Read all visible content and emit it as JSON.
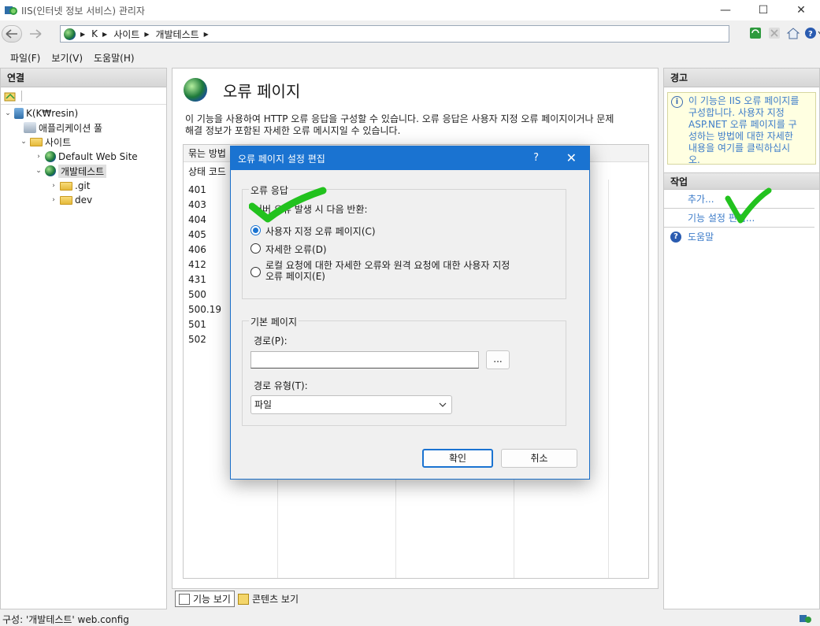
{
  "window": {
    "title": "IIS(인터넷 정보 서비스) 관리자",
    "minimize": "—",
    "maximize": "☐",
    "close": "✕"
  },
  "address": {
    "segments": [
      "K",
      "사이트",
      "개발테스트"
    ]
  },
  "menu": [
    "파일(F)",
    "보기(V)",
    "도움말(H)"
  ],
  "connections": {
    "header": "연결",
    "tree": [
      {
        "label": "K(K₩resin)",
        "level": 0,
        "twisty": "⌄",
        "icon": "server"
      },
      {
        "label": "애플리케이션 풀",
        "level": 1,
        "twisty": "",
        "icon": "pool"
      },
      {
        "label": "사이트",
        "level": 1,
        "twisty": "⌄",
        "icon": "folder"
      },
      {
        "label": "Default Web Site",
        "level": 2,
        "twisty": "›",
        "icon": "globe"
      },
      {
        "label": "개발테스트",
        "level": 2,
        "twisty": "⌄",
        "icon": "globe",
        "selected": true
      },
      {
        "label": ".git",
        "level": 3,
        "twisty": "›",
        "icon": "folder"
      },
      {
        "label": "dev",
        "level": 3,
        "twisty": "›",
        "icon": "folder"
      }
    ]
  },
  "center": {
    "title": "오류 페이지",
    "description_1": "이 기능을 사용하여 HTTP 오류 응답을 구성할 수 있습니다. 오류 응답은 사용자 지정 오류 페이지이거나 문제",
    "description_2": "해결 정보가 포함된 자세한 오류 메시지일 수 있습니다.",
    "group_label": "묶는 방법",
    "column_status": "상태 코드",
    "status_codes": [
      "401",
      "403",
      "404",
      "405",
      "406",
      "412",
      "431",
      "500",
      "500.19",
      "501",
      "502"
    ],
    "tab_features": "기능 보기",
    "tab_content": "콘텐츠 보기"
  },
  "alerts": {
    "header": "경고",
    "message_lines": [
      "이 기능은 IIS 오류 페이지를",
      "구성합니다. 사용자 지정",
      "ASP.NET 오류 페이지를 구",
      "성하는 방법에 대한 자세한",
      "내용을 여기를 클릭하십시",
      "오."
    ]
  },
  "actions": {
    "header": "작업",
    "add": "추가...",
    "edit_feature": "기능 설정 편집...",
    "help": "도움말"
  },
  "status": "구성: '개발테스트' web.config",
  "dialog": {
    "title": "오류 페이지 설정 편집",
    "help": "?",
    "close": "✕",
    "error_response_legend": "오류 응답",
    "prompt": "서버 오류 발생 시 다음 반환:",
    "options": [
      {
        "label": "사용자 지정 오류 페이지(C)",
        "selected": true
      },
      {
        "label": "자세한 오류(D)",
        "selected": false
      },
      {
        "label_1": "로컬 요청에 대한 자세한 오류와 원격 요청에 대한 사용자 지정",
        "label_2": "오류 페이지(E)",
        "selected": false
      }
    ],
    "default_page_legend": "기본 페이지",
    "path_label": "경로(P):",
    "path_value": "",
    "browse": "...",
    "path_type_label": "경로 유형(T):",
    "path_type_value": "파일",
    "ok": "확인",
    "cancel": "취소"
  },
  "colors": {
    "accent": "#1a73d1",
    "link": "#3d7cc9",
    "check": "#22c21e"
  }
}
